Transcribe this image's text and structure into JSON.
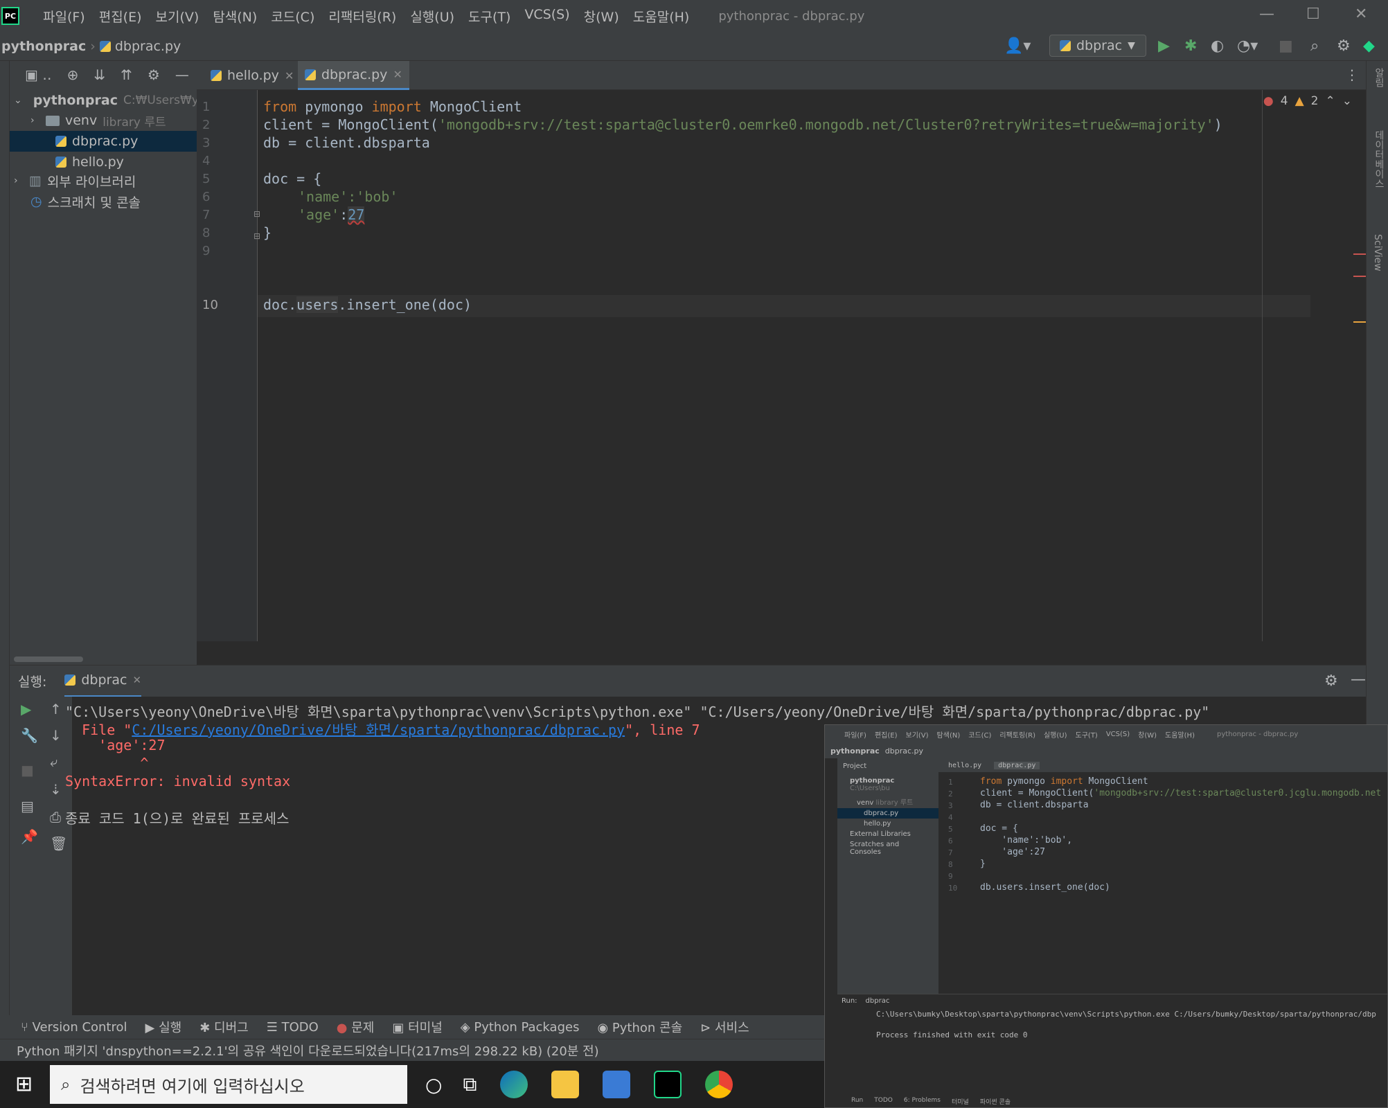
{
  "menu": [
    "파일(F)",
    "편집(E)",
    "보기(V)",
    "탐색(N)",
    "코드(C)",
    "리팩터링(R)",
    "실행(U)",
    "도구(T)",
    "VCS(S)",
    "창(W)",
    "도움말(H)"
  ],
  "window_title": "pythonprac - dbprac.py",
  "app_logo": "PC",
  "breadcrumb": {
    "project": "pythonprac",
    "file": "dbprac.py"
  },
  "run_config": "dbprac",
  "project_tree": {
    "root": "pythonprac",
    "root_path": "C:₩Users₩y",
    "venv": "venv",
    "venv_note": "library 루트",
    "file1": "dbprac.py",
    "file2": "hello.py",
    "ext_libs": "외부 라이브러리",
    "scratches": "스크래치 및 콘솔"
  },
  "tabs": [
    {
      "label": "hello.py"
    },
    {
      "label": "dbprac.py"
    }
  ],
  "inspections": {
    "errors": "4",
    "warnings": "2"
  },
  "code": {
    "l1_from": "from",
    "l1_mod": " pymongo ",
    "l1_import": "import",
    "l1_cls": " MongoClient",
    "l2_a": "client = MongoClient(",
    "l2_str": "'mongodb+srv://test:sparta@cluster0.oemrke0.mongodb.net/Cluster0?retryWrites=true&w=majority'",
    "l2_b": ")",
    "l3": "db = client.dbsparta",
    "l5": "doc = {",
    "l6": "'name':'bob'",
    "l7_key": "'age'",
    "l7_colon": ":",
    "l7_num": "27",
    "l8": "}",
    "l10_a": "doc.",
    "l10_users": "users",
    "l10_b": ".insert_one(",
    "l10_arg": "doc",
    "l10_c": ")"
  },
  "line_numbers": [
    "1",
    "2",
    "3",
    "4",
    "5",
    "6",
    "7",
    "8",
    "9",
    "10"
  ],
  "run_panel": {
    "label": "실행:",
    "tab": "dbprac",
    "cmd": "\"C:\\Users\\yeony\\OneDrive\\바탕 화면\\sparta\\pythonprac\\venv\\Scripts\\python.exe\" \"C:/Users/yeony/OneDrive/바탕 화면/sparta/pythonprac/dbprac.py\"",
    "file_prefix": "  File \"",
    "file_link": "C:/Users/yeony/OneDrive/바탕 화면/sparta/pythonprac/dbprac.py",
    "file_suffix": "\", line 7",
    "err_line": "    'age':27",
    "caret": "         ^",
    "syntax_error": "SyntaxError: invalid syntax",
    "exit_msg": "종료 코드 1(으)로 완료된 프로세스"
  },
  "bottom_tools": [
    "Version Control",
    "실행",
    "디버그",
    "TODO",
    "문제",
    "터미널",
    "Python Packages",
    "Python 콘솔",
    "서비스"
  ],
  "status": "Python 패키지 'dnspython==2.2.1'의 공유 색인이 다운로드되었습니다(217ms의 298.22 kB) (20분 전)",
  "taskbar": {
    "search_placeholder": "검색하려면 여기에 입력하십시오"
  },
  "right_strip": {
    "database": "데이터베이스",
    "sciview": "SciView",
    "notifications": "알림"
  },
  "overlay": {
    "menu": [
      "파일(F)",
      "편집(E)",
      "보기(V)",
      "탐색(N)",
      "코드(C)",
      "리팩토링(R)",
      "실행(U)",
      "도구(T)",
      "VCS(S)",
      "창(W)",
      "도움말(H)"
    ],
    "title": "pythonprac - dbprac.py",
    "bc_project": "pythonprac",
    "bc_file": "dbprac.py",
    "project_label": "Project",
    "tree_root": "pythonprac",
    "tree_root_path": "C:\\Users\\bu",
    "tree_venv": "venv",
    "tree_venv_note": "library 루트",
    "tree_f1": "dbprac.py",
    "tree_f2": "hello.py",
    "tree_ext": "External Libraries",
    "tree_scratch": "Scratches and Consoles",
    "tab1": "hello.py",
    "tab2": "dbprac.py",
    "l1_from": "from",
    "l1_mod": " pymongo ",
    "l1_import": "import",
    "l1_cls": " MongoClient",
    "l2_a": "client = MongoClient(",
    "l2_str": "'mongodb+srv://test:sparta@cluster0.jcglu.mongodb.net",
    "l3": "db = client.dbsparta",
    "l5": "doc = {",
    "l6": "    'name':'bob',",
    "l7": "    'age':27",
    "l8": "}",
    "l10": "db.users.insert_one(doc)",
    "line_numbers": [
      "1",
      "2",
      "3",
      "4",
      "5",
      "6",
      "7",
      "8",
      "9",
      "10"
    ],
    "run_label": "Run:",
    "run_tab": "dbprac",
    "run_cmd": "C:\\Users\\bumky\\Desktop\\sparta\\pythonprac\\venv\\Scripts\\python.exe C:/Users/bumky/Desktop/sparta/pythonprac/dbp",
    "run_exit": "Process finished with exit code 0",
    "bottom": [
      "Run",
      "TODO",
      "6: Problems",
      "터미널",
      "파이썬 콘솔"
    ]
  }
}
